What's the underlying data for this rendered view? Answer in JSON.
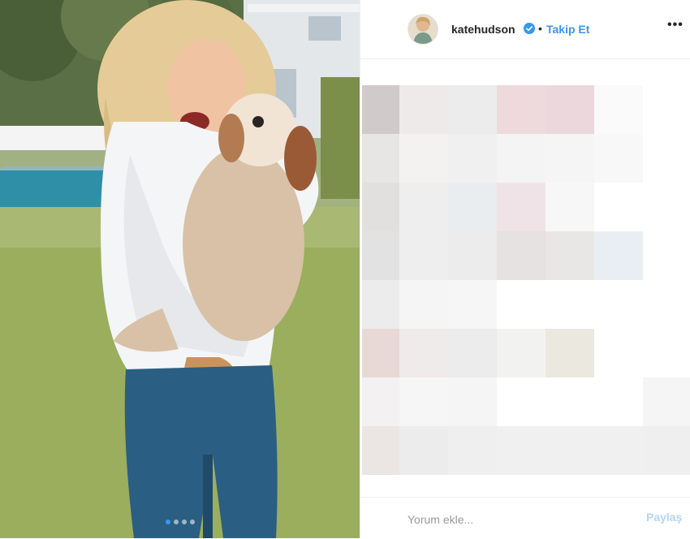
{
  "post": {
    "username": "katehudson",
    "separator": "•",
    "follow_label": "Takip Et",
    "more_label": "•••",
    "comment_placeholder": "Yorum ekle...",
    "share_label": "Paylaş"
  },
  "colors": {
    "accent": "#3897f0",
    "share_disabled": "#b3d7f9",
    "border": "#efefef",
    "text": "#262626"
  },
  "icons": {
    "verified": "verified-badge-icon",
    "more": "more-options-icon"
  },
  "carousel": {
    "count": 4,
    "active_index": 0
  }
}
